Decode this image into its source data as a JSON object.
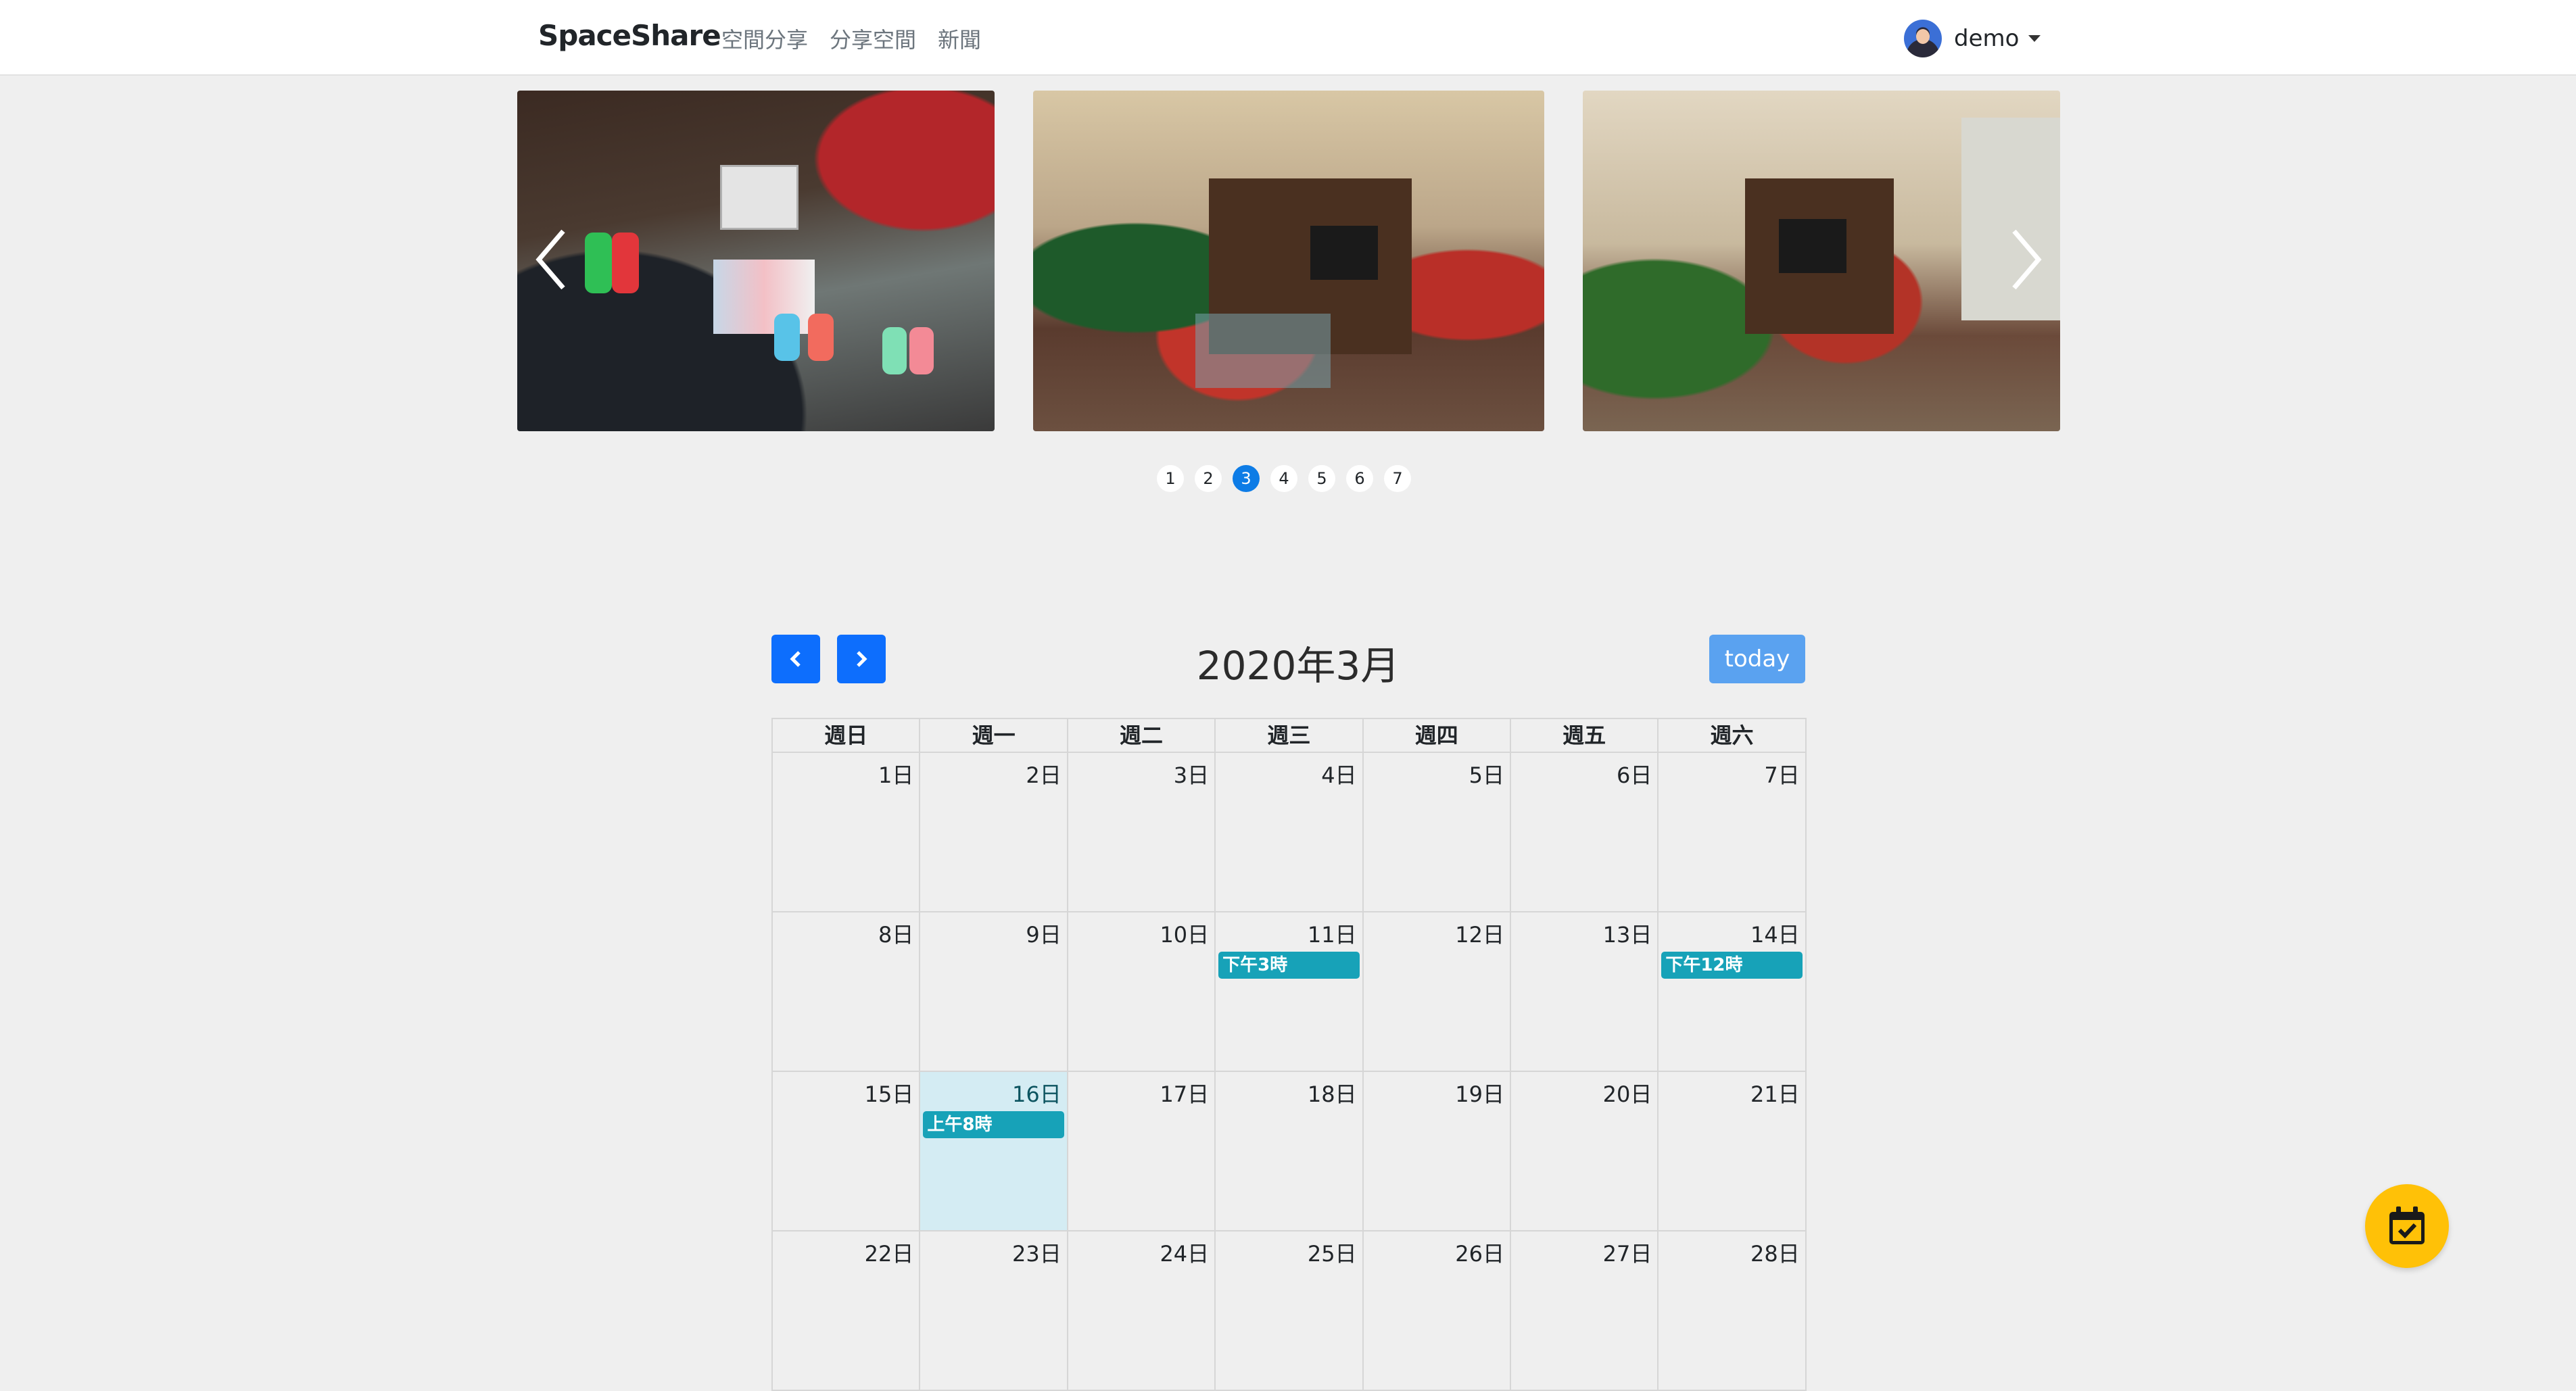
{
  "navbar": {
    "brand": "SpaceShare",
    "links": [
      "空間分享",
      "分享空間",
      "新聞"
    ],
    "user": "demo"
  },
  "carousel": {
    "indicators": [
      "1",
      "2",
      "3",
      "4",
      "5",
      "6",
      "7"
    ],
    "active_index": 3
  },
  "calendar": {
    "title": "2020年3月",
    "today_label": "today",
    "weekdays": [
      "週日",
      "週一",
      "週二",
      "週三",
      "週四",
      "週五",
      "週六"
    ],
    "weeks": [
      [
        {
          "d": "1日"
        },
        {
          "d": "2日"
        },
        {
          "d": "3日"
        },
        {
          "d": "4日"
        },
        {
          "d": "5日"
        },
        {
          "d": "6日"
        },
        {
          "d": "7日"
        }
      ],
      [
        {
          "d": "8日"
        },
        {
          "d": "9日"
        },
        {
          "d": "10日"
        },
        {
          "d": "11日",
          "event": "下午3時"
        },
        {
          "d": "12日"
        },
        {
          "d": "13日"
        },
        {
          "d": "14日",
          "event": "下午12時"
        }
      ],
      [
        {
          "d": "15日"
        },
        {
          "d": "16日",
          "event": "上午8時",
          "today": true
        },
        {
          "d": "17日"
        },
        {
          "d": "18日"
        },
        {
          "d": "19日"
        },
        {
          "d": "20日"
        },
        {
          "d": "21日"
        }
      ],
      [
        {
          "d": "22日"
        },
        {
          "d": "23日"
        },
        {
          "d": "24日"
        },
        {
          "d": "25日"
        },
        {
          "d": "26日"
        },
        {
          "d": "27日"
        },
        {
          "d": "28日"
        }
      ]
    ]
  },
  "colors": {
    "primary": "#0d6efd",
    "event": "#17a2b8",
    "today_bg": "#d4ecf3",
    "fab": "#ffc107"
  },
  "icons": {
    "prev": "chevron-left-icon",
    "next": "chevron-right-icon",
    "fab": "calendar-check-icon"
  }
}
